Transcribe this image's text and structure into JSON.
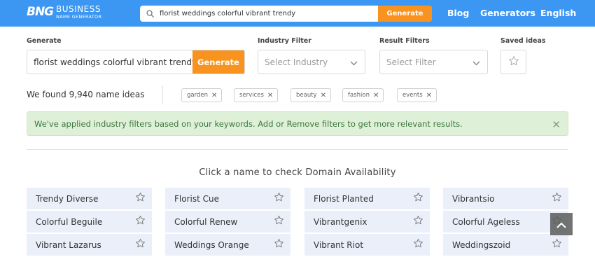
{
  "brand": {
    "mark": "BNG",
    "line1": "BUSINESS",
    "line2": "NAME GENERATOR"
  },
  "header": {
    "search_value": "florist weddings colorful vibrant trendy",
    "search_button": "Generate",
    "nav": [
      "Blog",
      "Generators",
      "English"
    ]
  },
  "filters": {
    "generate_label": "Generate",
    "generate_value": "florist weddings colorful vibrant trendy",
    "generate_button": "Generate",
    "industry_label": "Industry Filter",
    "industry_value": "Select Industry",
    "result_label": "Result Filters",
    "result_value": "Select Filter",
    "saved_label": "Saved ideas"
  },
  "results": {
    "count_text": "We found 9,940 name ideas",
    "tags": [
      "garden",
      "services",
      "beauty",
      "fashion",
      "events"
    ],
    "notice": "We've applied industry filters based on your keywords. Add or Remove filters to get more relevant results.",
    "subtitle": "Click a name to check Domain Availability",
    "names": [
      [
        "Trendy Diverse",
        "Florist Cue",
        "Florist Planted",
        "Vibrantsio"
      ],
      [
        "Colorful Beguile",
        "Colorful Renew",
        "Vibrantgenix",
        "Colorful Ageless"
      ],
      [
        "Vibrant Lazarus",
        "Weddings Orange",
        "Vibrant Riot",
        "Weddingszoid"
      ]
    ]
  },
  "colors": {
    "header_bg": "#3b97f1",
    "accent": "#f7931e",
    "card_bg": "#eaeff9",
    "notice_bg": "#dff0d8",
    "notice_text": "#3c763d"
  },
  "icons": {
    "search": "search-icon",
    "chevron": "chevron-down-icon",
    "star": "star-outline-icon",
    "close": "close-icon",
    "arrow_up": "chevron-up-icon"
  }
}
